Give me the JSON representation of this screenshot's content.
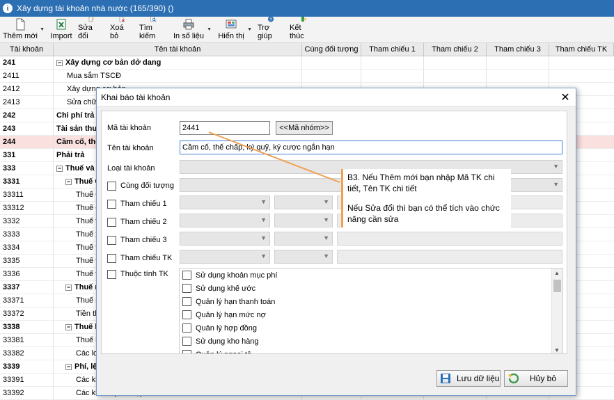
{
  "window": {
    "title": "Xây dựng tài khoản nhà nước (165/390) ()"
  },
  "toolbar": {
    "items": [
      {
        "label": "Thêm mới",
        "icon": "new-document-icon",
        "has_dropdown": true
      },
      {
        "label": "Import",
        "icon": "excel-import-icon",
        "has_dropdown": false
      },
      {
        "label": "Sửa đổi",
        "icon": "edit-icon",
        "has_dropdown": false
      },
      {
        "label": "Xoá bỏ",
        "icon": "delete-icon",
        "has_dropdown": false
      },
      {
        "label": "Tìm kiếm",
        "icon": "search-icon",
        "has_dropdown": false
      },
      {
        "label": "In số liệu",
        "icon": "printer-icon",
        "has_dropdown": true
      },
      {
        "label": "Hiển thị",
        "icon": "display-icon",
        "has_dropdown": true
      },
      {
        "label": "Trợ giúp",
        "icon": "help-icon",
        "has_dropdown": false
      },
      {
        "label": "Kết thúc",
        "icon": "exit-icon",
        "has_dropdown": false
      }
    ]
  },
  "grid": {
    "columns": [
      "Tài khoản",
      "Tên tài khoản",
      "Cùng đối tượng",
      "Tham chiếu 1",
      "Tham chiếu 2",
      "Tham chiếu 3",
      "Tham chiếu TK"
    ],
    "rows": [
      {
        "code": "241",
        "name": "Xây dựng cơ bản dở dang",
        "bold": true,
        "expander": "−",
        "indent": 0
      },
      {
        "code": "2411",
        "name": "Mua sắm TSCĐ",
        "bold": false,
        "expander": "",
        "indent": 1
      },
      {
        "code": "2412",
        "name": "Xây dựng cơ bản",
        "bold": false,
        "expander": "",
        "indent": 1
      },
      {
        "code": "2413",
        "name": "Sửa chữa lớn",
        "bold": false,
        "expander": "",
        "indent": 1
      },
      {
        "code": "242",
        "name": "Chi phí trả trước",
        "bold": true,
        "expander": "",
        "indent": 0
      },
      {
        "code": "243",
        "name": "Tài sản thuần",
        "bold": true,
        "expander": "",
        "indent": 0
      },
      {
        "code": "244",
        "name": "Cầm cố, thế chấp",
        "bold": true,
        "expander": "",
        "indent": 0,
        "selected": true
      },
      {
        "code": "331",
        "name": "Phải trả",
        "bold": true,
        "expander": "",
        "indent": 0
      },
      {
        "code": "333",
        "name": "Thuế và các khoản",
        "bold": true,
        "expander": "−",
        "indent": 0
      },
      {
        "code": "3331",
        "name": "Thuế GTGT",
        "bold": true,
        "expander": "−",
        "indent": 1
      },
      {
        "code": "33311",
        "name": "Thuế GTGT đầu ra",
        "bold": false,
        "expander": "",
        "indent": 2
      },
      {
        "code": "33312",
        "name": "Thuế GTGT hàng nhập khẩu",
        "bold": false,
        "expander": "",
        "indent": 2
      },
      {
        "code": "3332",
        "name": "Thuế tiêu thụ đặc biệt",
        "bold": false,
        "expander": "",
        "indent": 2
      },
      {
        "code": "3333",
        "name": "Thuế xuất, nhập khẩu",
        "bold": false,
        "expander": "",
        "indent": 2
      },
      {
        "code": "3334",
        "name": "Thuế thu nhập doanh nghiệp",
        "bold": false,
        "expander": "",
        "indent": 2
      },
      {
        "code": "3335",
        "name": "Thuế thu nhập cá nhân",
        "bold": false,
        "expander": "",
        "indent": 2
      },
      {
        "code": "3336",
        "name": "Thuế tài nguyên",
        "bold": false,
        "expander": "",
        "indent": 2
      },
      {
        "code": "3337",
        "name": "Thuế nhà đất",
        "bold": true,
        "expander": "−",
        "indent": 1
      },
      {
        "code": "33371",
        "name": "Thuế nhà đất",
        "bold": false,
        "expander": "",
        "indent": 2
      },
      {
        "code": "33372",
        "name": "Tiền thuê đất",
        "bold": false,
        "expander": "",
        "indent": 2
      },
      {
        "code": "3338",
        "name": "Thuế khác",
        "bold": true,
        "expander": "−",
        "indent": 1
      },
      {
        "code": "33381",
        "name": "Thuế bảo vệ môi trường",
        "bold": false,
        "expander": "",
        "indent": 2
      },
      {
        "code": "33382",
        "name": "Các loại thuế khác",
        "bold": false,
        "expander": "",
        "indent": 2
      },
      {
        "code": "3339",
        "name": "Phí, lệ phí",
        "bold": true,
        "expander": "−",
        "indent": 1
      },
      {
        "code": "33391",
        "name": "Các khoản phí",
        "bold": false,
        "expander": "",
        "indent": 2
      },
      {
        "code": "33392",
        "name": "Các khoản phải nộp",
        "bold": false,
        "expander": "",
        "indent": 2
      }
    ]
  },
  "dialog": {
    "title": "Khai báo tài khoản",
    "ma_tai_khoan_label": "Mã tài khoản",
    "ma_tai_khoan_value": "2441",
    "ma_nhom_button": "<<Mã nhóm>>",
    "ten_tai_khoan_label": "Tên tài khoản",
    "ten_tai_khoan_value": "Cầm cố, thế chấp, ký quỹ, ký cược ngắn hạn",
    "loai_tai_khoan_label": "Loại tài khoản",
    "cung_doi_tuong_label": "Cùng đối tượng",
    "tham_chieu_1_label": "Tham chiếu 1",
    "tham_chieu_2_label": "Tham chiếu 2",
    "tham_chieu_3_label": "Tham chiếu 3",
    "tham_chieu_tk_label": "Tham chiếu TK",
    "thuoc_tinh_tk_label": "Thuộc tính TK",
    "attributes": [
      "Sử dụng khoản mục phí",
      "Sử dụng khế ước",
      "Quản lý hạn thanh toán",
      "Quản lý hạn mức nợ",
      "Quản lý hợp đồng",
      "Sử dụng kho hàng",
      "Quản lý ngoại tệ"
    ],
    "save_button": "Lưu dữ liệu",
    "cancel_button": "Hủy bỏ"
  },
  "callout": {
    "line1": "B3. Nếu Thêm mới bạn nhập Mã TK chi tiết, Tên TK chi tiết",
    "line2": "Nếu Sửa đổi thì bạn có thể tích vào chức năng cần sửa",
    "accent_color": "#f0a150"
  },
  "colors": {
    "titlebar": "#2d6fb3",
    "selected_row": "#fbe0e0",
    "focus_border": "#3c7fd6"
  }
}
